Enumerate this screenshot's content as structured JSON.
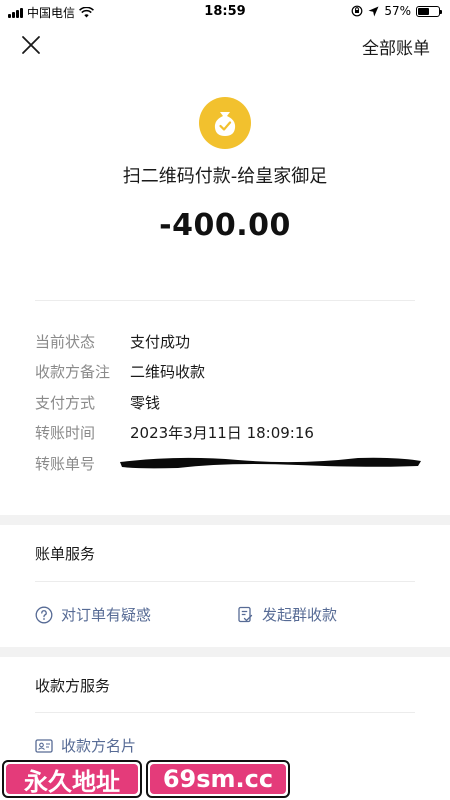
{
  "status_bar": {
    "carrier": "中国电信",
    "time": "18:59",
    "battery": "57%",
    "battery_level": 0.57,
    "icons": [
      "signal-icon",
      "wifi-icon",
      "orientation-lock-icon",
      "location-icon",
      "battery-icon"
    ]
  },
  "nav": {
    "close_icon": "close-icon",
    "all_bills": "全部账单"
  },
  "payment": {
    "icon": "money-bag-icon",
    "icon_color": "#f2c12e",
    "title": "扫二维码付款-给皇家御足",
    "amount": "-400.00"
  },
  "details": [
    {
      "label": "当前状态",
      "value": "支付成功"
    },
    {
      "label": "收款方备注",
      "value": "二维码收款"
    },
    {
      "label": "支付方式",
      "value": "零钱"
    },
    {
      "label": "转账时间",
      "value": "2023年3月11日 18:09:16"
    },
    {
      "label": "转账单号",
      "value": ""
    }
  ],
  "bill_service": {
    "title": "账单服务",
    "actions": [
      {
        "label": "对订单有疑惑",
        "icon": "question-circle-icon"
      },
      {
        "label": "发起群收款",
        "icon": "group-collect-icon"
      }
    ]
  },
  "payee_service": {
    "title": "收款方服务",
    "actions": [
      {
        "label": "收款方名片",
        "icon": "business-card-icon"
      }
    ]
  },
  "watermark": {
    "left": "永久地址",
    "right": "69sm.cc",
    "color": "#e43b7a"
  },
  "colors": {
    "link": "#576b95",
    "label": "#8a8a8a",
    "accent": "#f2c12e"
  }
}
